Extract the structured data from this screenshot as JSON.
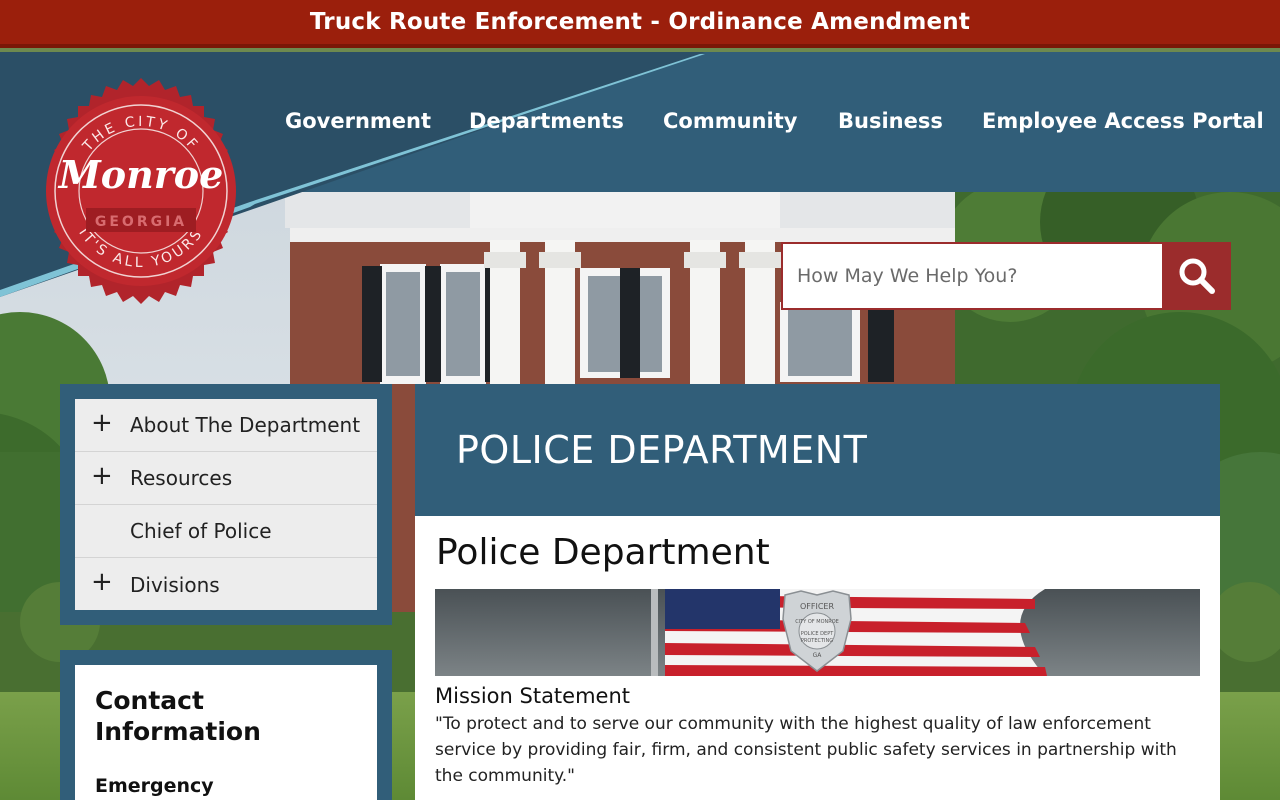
{
  "alert": {
    "text": "Truck Route Enforcement - Ordinance Amendment"
  },
  "logo": {
    "top_text": "THE CITY OF",
    "name": "Monroe",
    "state": "GEORGIA",
    "bottom_text": "IT'S ALL YOURS"
  },
  "nav": {
    "items": [
      {
        "label": "Government"
      },
      {
        "label": "Departments"
      },
      {
        "label": "Community"
      },
      {
        "label": "Business"
      },
      {
        "label": "Employee Access Portal"
      }
    ]
  },
  "search": {
    "placeholder": "How May We Help You?",
    "icon": "search-icon"
  },
  "sidenav": {
    "items": [
      {
        "label": "About The Department",
        "expandable": true
      },
      {
        "label": "Resources",
        "expandable": true
      },
      {
        "label": "Chief of Police",
        "expandable": false
      },
      {
        "label": "Divisions",
        "expandable": true
      }
    ],
    "expand_glyph": "+"
  },
  "contact": {
    "title": "Contact Information",
    "subheading": "Emergency"
  },
  "page": {
    "banner_title": "POLICE DEPARTMENT",
    "heading": "Police Department",
    "badge_text": {
      "top": "OFFICER",
      "ring": "CITY OF MONROE",
      "center": "POLICE DEPT",
      "lower": "PROTECTING",
      "state": "GA"
    },
    "mission_title": "Mission Statement",
    "mission_text": "\"To protect and to serve our community with the highest quality of law enforcement service by providing fair, firm, and consistent public safety services in partnership with the community.\""
  },
  "colors": {
    "alert_bg": "#9b1f0c",
    "header_bg": "#315e79",
    "accent_red": "#9b2c2c",
    "logo_red": "#c0282e",
    "diagonal_accent": "#7fc3d6"
  }
}
